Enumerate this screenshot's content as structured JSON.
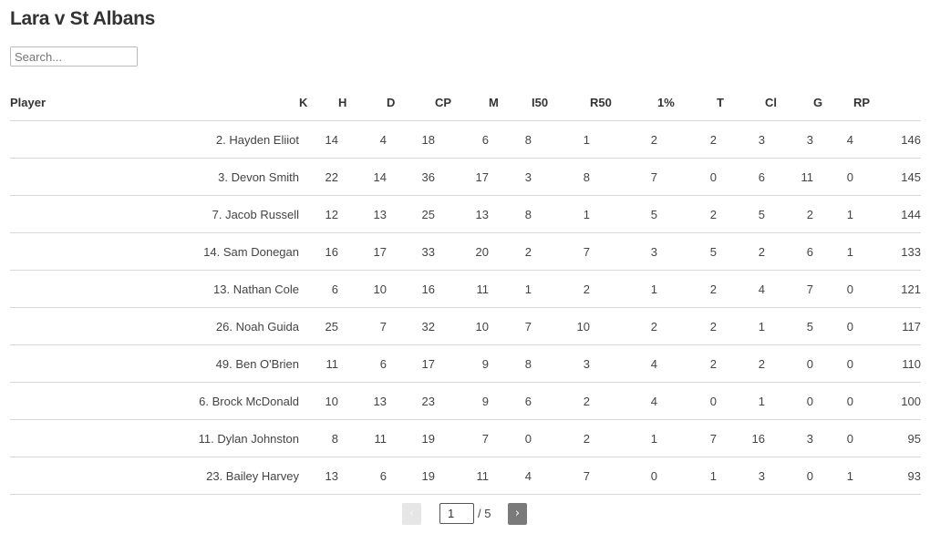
{
  "title": "Lara v St Albans",
  "search": {
    "placeholder": "Search...",
    "value": ""
  },
  "table": {
    "columns": [
      "Player",
      "K",
      "H",
      "D",
      "CP",
      "M",
      "I50",
      "R50",
      "1%",
      "T",
      "Cl",
      "G",
      "RP"
    ],
    "rows": [
      {
        "num": "2.",
        "name": "Hayden Eliiot",
        "stats": [
          "14",
          "4",
          "18",
          "6",
          "8",
          "1",
          "2",
          "2",
          "3",
          "3",
          "4",
          "146"
        ]
      },
      {
        "num": "3.",
        "name": "Devon Smith",
        "stats": [
          "22",
          "14",
          "36",
          "17",
          "3",
          "8",
          "7",
          "0",
          "6",
          "11",
          "0",
          "145"
        ]
      },
      {
        "num": "7.",
        "name": "Jacob Russell",
        "stats": [
          "12",
          "13",
          "25",
          "13",
          "8",
          "1",
          "5",
          "2",
          "5",
          "2",
          "1",
          "144"
        ]
      },
      {
        "num": "14.",
        "name": "Sam Donegan",
        "stats": [
          "16",
          "17",
          "33",
          "20",
          "2",
          "7",
          "3",
          "5",
          "2",
          "6",
          "1",
          "133"
        ]
      },
      {
        "num": "13.",
        "name": "Nathan Cole",
        "stats": [
          "6",
          "10",
          "16",
          "11",
          "1",
          "2",
          "1",
          "2",
          "4",
          "7",
          "0",
          "121"
        ]
      },
      {
        "num": "26.",
        "name": "Noah Guida",
        "stats": [
          "25",
          "7",
          "32",
          "10",
          "7",
          "10",
          "2",
          "2",
          "1",
          "5",
          "0",
          "117"
        ]
      },
      {
        "num": "49.",
        "name": "Ben O'Brien",
        "stats": [
          "11",
          "6",
          "17",
          "9",
          "8",
          "3",
          "4",
          "2",
          "2",
          "0",
          "0",
          "110"
        ]
      },
      {
        "num": "6.",
        "name": "Brock McDonald",
        "stats": [
          "10",
          "13",
          "23",
          "9",
          "6",
          "2",
          "4",
          "0",
          "1",
          "0",
          "0",
          "100"
        ]
      },
      {
        "num": "11.",
        "name": "Dylan Johnston",
        "stats": [
          "8",
          "11",
          "19",
          "7",
          "0",
          "2",
          "1",
          "7",
          "16",
          "3",
          "0",
          "95"
        ]
      },
      {
        "num": "23.",
        "name": "Bailey Harvey",
        "stats": [
          "13",
          "6",
          "19",
          "11",
          "4",
          "7",
          "0",
          "1",
          "3",
          "0",
          "1",
          "93"
        ]
      }
    ]
  },
  "pagination": {
    "prev_label": "‹",
    "next_label": "›",
    "current_page": "1",
    "total_label": "/ 5"
  }
}
